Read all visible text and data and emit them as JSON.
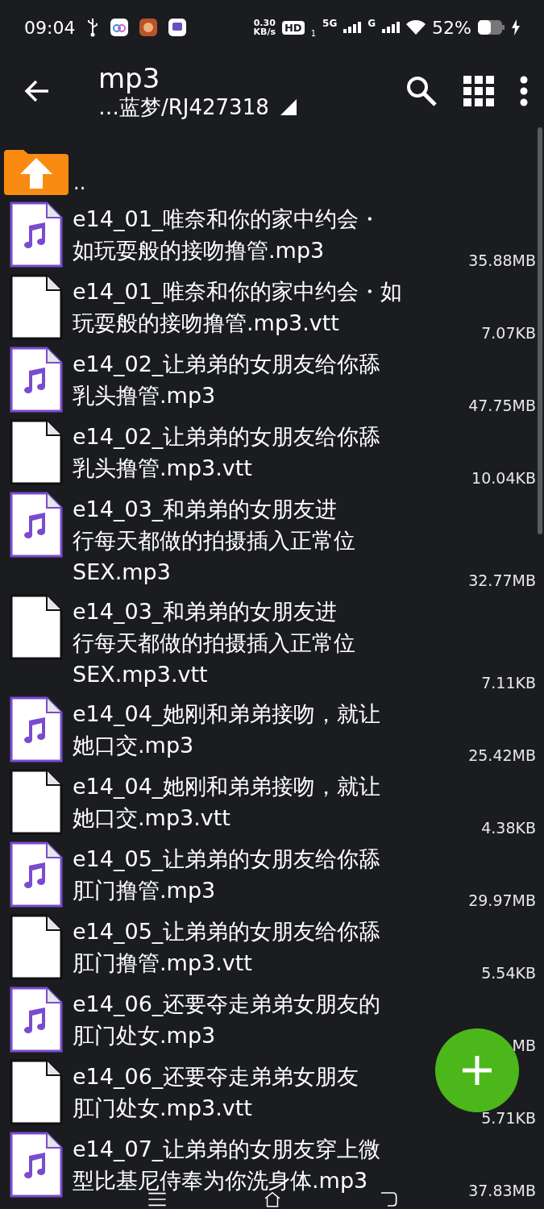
{
  "status_bar": {
    "time": "09:04",
    "net_speed": "0.30",
    "net_unit": "KB/s",
    "hd": "HD",
    "sim": "1",
    "net1": "5G",
    "net2": "G",
    "battery": "52%"
  },
  "toolbar": {
    "title": "mp3",
    "path": "…蓝梦/RJ427318"
  },
  "parent": {
    "label": ".."
  },
  "files": [
    {
      "kind": "audio",
      "lines": [
        "e14_01_唯奈和你的家中约会・",
        "如玩耍般的接吻撸管.mp3"
      ],
      "size": "35.88MB"
    },
    {
      "kind": "text",
      "lines": [
        "e14_01_唯奈和你的家中约会・如",
        "玩耍般的接吻撸管.mp3.vtt"
      ],
      "size": "7.07KB"
    },
    {
      "kind": "audio",
      "lines": [
        "e14_02_让弟弟的女朋友给你舔",
        "乳头撸管.mp3"
      ],
      "size": "47.75MB"
    },
    {
      "kind": "text",
      "lines": [
        "e14_02_让弟弟的女朋友给你舔",
        "乳头撸管.mp3.vtt"
      ],
      "size": "10.04KB"
    },
    {
      "kind": "audio",
      "lines": [
        "e14_03_和弟弟的女朋友进",
        "行每天都做的拍摄插入正常位",
        "SEX.mp3"
      ],
      "size": "32.77MB"
    },
    {
      "kind": "text",
      "lines": [
        "e14_03_和弟弟的女朋友进",
        "行每天都做的拍摄插入正常位",
        "SEX.mp3.vtt"
      ],
      "size": "7.11KB"
    },
    {
      "kind": "audio",
      "lines": [
        "e14_04_她刚和弟弟接吻，就让",
        "她口交.mp3"
      ],
      "size": "25.42MB"
    },
    {
      "kind": "text",
      "lines": [
        "e14_04_她刚和弟弟接吻，就让",
        "她口交.mp3.vtt"
      ],
      "size": "4.38KB"
    },
    {
      "kind": "audio",
      "lines": [
        "e14_05_让弟弟的女朋友给你舔",
        "肛门撸管.mp3"
      ],
      "size": "29.97MB"
    },
    {
      "kind": "text",
      "lines": [
        "e14_05_让弟弟的女朋友给你舔",
        "肛门撸管.mp3.vtt"
      ],
      "size": "5.54KB"
    },
    {
      "kind": "audio",
      "lines": [
        "e14_06_还要夺走弟弟女朋友的",
        "肛门处女.mp3"
      ],
      "size": "MB"
    },
    {
      "kind": "text",
      "lines": [
        "e14_06_还要夺走弟弟女朋友",
        "肛门处女.mp3.vtt"
      ],
      "size": "5.71KB"
    },
    {
      "kind": "audio",
      "lines": [
        "e14_07_让弟弟的女朋友穿上微",
        "型比基尼侍奉为你洗身体.mp3"
      ],
      "size": "37.83MB"
    }
  ]
}
